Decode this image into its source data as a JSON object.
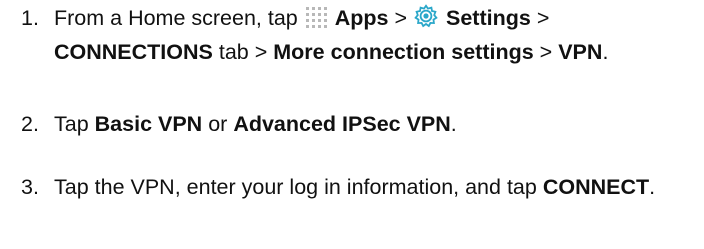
{
  "steps": [
    {
      "number": "1.",
      "parts": {
        "t0": "From a Home screen, tap",
        "apps": "Apps",
        "sep1": ">",
        "settings": "Settings",
        "sep2": ">",
        "connections": "CONNECTIONS",
        "tab": "tab >",
        "more": "More connection settings",
        "sep3": ">",
        "vpn": "VPN",
        "end": "."
      },
      "icons": [
        "apps-grid-icon",
        "settings-gear-icon"
      ]
    },
    {
      "number": "2.",
      "parts": {
        "t0": "Tap",
        "basic": "Basic VPN",
        "or": "or",
        "advanced": "Advanced IPSec VPN",
        "end": "."
      }
    },
    {
      "number": "3.",
      "parts": {
        "t0": "Tap the VPN, enter your log in information, and tap",
        "connect": "CONNECT",
        "end": "."
      }
    }
  ],
  "colors": {
    "text": "#111111",
    "apps_icon": "#b8b8b8",
    "settings_icon": "#2aa7c9"
  }
}
